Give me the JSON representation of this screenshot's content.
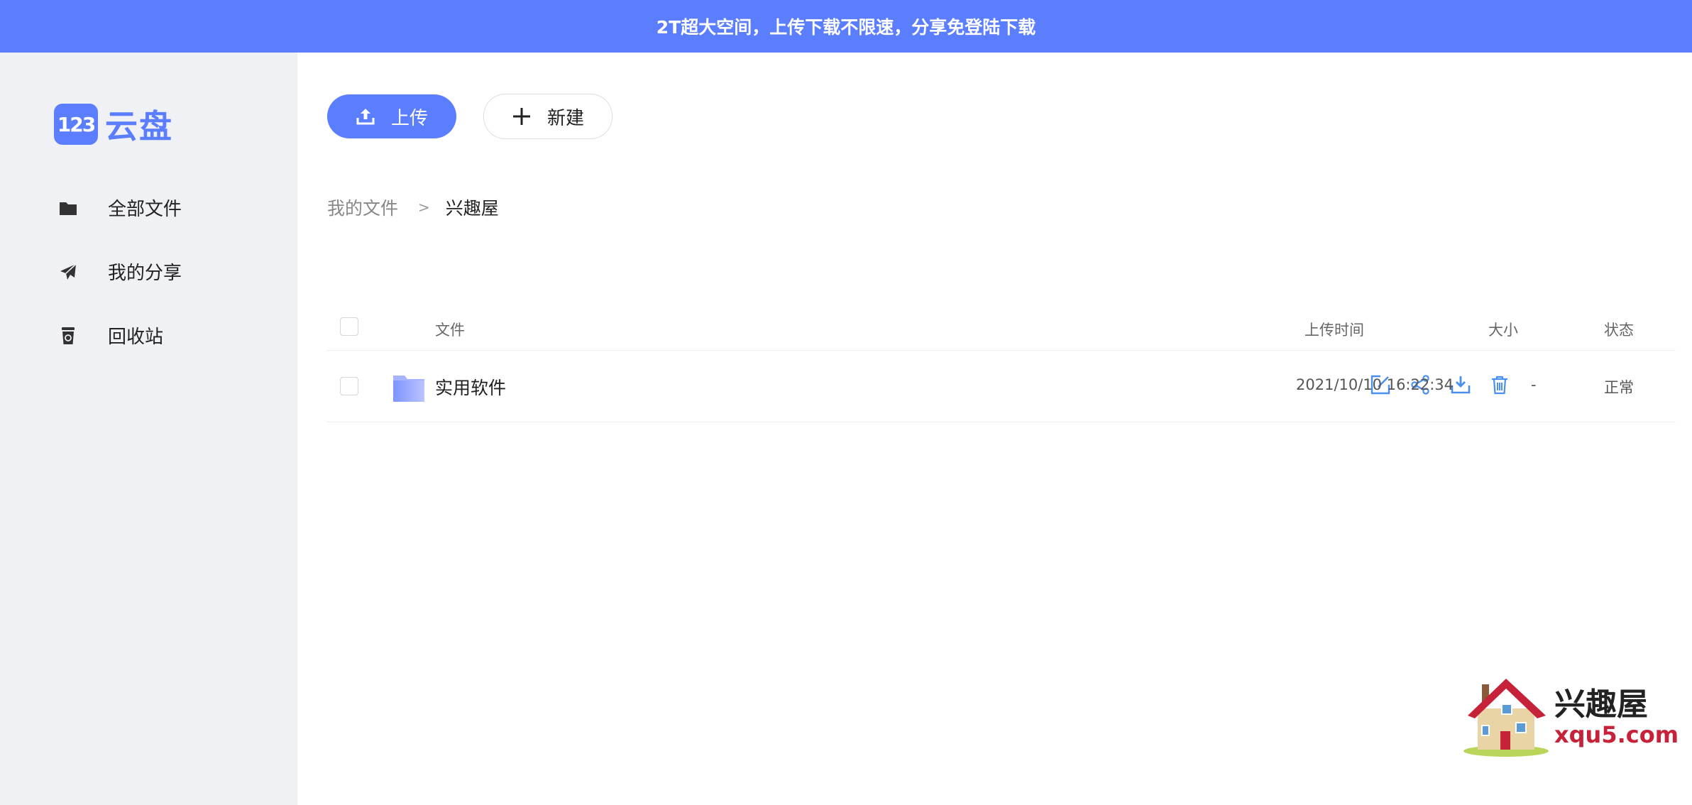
{
  "banner": {
    "text": "2T超大空间，上传下载不限速，分享免登陆下载"
  },
  "logo": {
    "badge": "123",
    "text": "云盘"
  },
  "sidebar": {
    "items": [
      {
        "label": "全部文件",
        "icon": "folder-icon"
      },
      {
        "label": "我的分享",
        "icon": "paper-plane-icon"
      },
      {
        "label": "回收站",
        "icon": "recycle-bin-icon"
      }
    ]
  },
  "toolbar": {
    "upload_label": "上传",
    "new_label": "新建"
  },
  "breadcrumb": {
    "root": "我的文件",
    "separator": ">",
    "current": "兴趣屋"
  },
  "table": {
    "headers": {
      "file": "文件",
      "upload_time": "上传时间",
      "size": "大小",
      "status": "状态"
    },
    "rows": [
      {
        "name": "实用软件",
        "type": "folder",
        "upload_time": "2021/10/10 16:22:34",
        "size": "-",
        "status": "正常",
        "actions": [
          "edit-icon",
          "share-icon",
          "download-icon",
          "delete-icon"
        ]
      }
    ]
  },
  "watermark": {
    "title": "兴趣屋",
    "url": "xqu5.com"
  },
  "colors": {
    "accent": "#5b7dff",
    "sidebar_bg": "#f0f1f5",
    "action_icon": "#4a90f0",
    "watermark_red": "#c6233a"
  }
}
